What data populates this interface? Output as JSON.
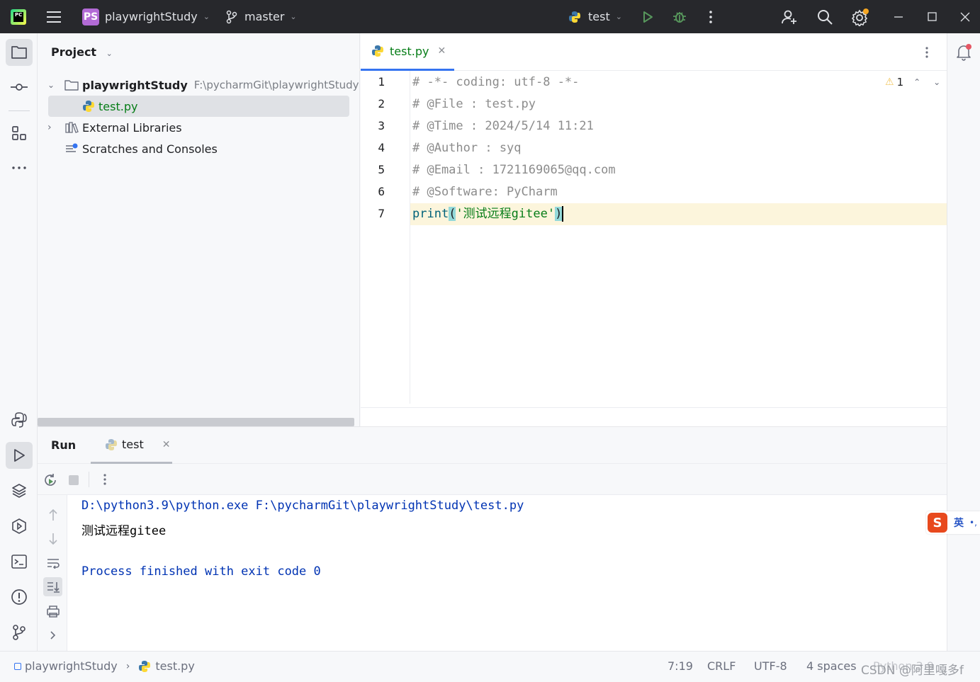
{
  "titlebar": {
    "project_badge": "PS",
    "project_name": "playwrightStudy",
    "branch": "master",
    "run_config": "test",
    "logo_text": "PC",
    "icons": [
      "pycharm-logo-icon",
      "hamburger-menu-icon",
      "branch-icon",
      "python-icon",
      "run-icon",
      "debug-icon",
      "more-vert-icon",
      "add-user-icon",
      "search-icon",
      "settings-icon",
      "minimize-icon",
      "maximize-icon",
      "close-icon"
    ]
  },
  "project_panel": {
    "title": "Project",
    "tree": [
      {
        "label": "playwrightStudy",
        "hint": "F:\\pycharmGit\\playwrightStudy",
        "icon": "folder-icon"
      },
      {
        "label": "test.py",
        "icon": "python-file-icon"
      },
      {
        "label": "External Libraries",
        "icon": "library-icon"
      },
      {
        "label": "Scratches and Consoles",
        "icon": "scratches-icon"
      }
    ]
  },
  "editor": {
    "tab_label": "test.py",
    "warning_count": "1",
    "line_numbers": [
      "1",
      "2",
      "3",
      "4",
      "5",
      "6",
      "7"
    ],
    "lines": [
      "# -*- coding: utf-8 -*-",
      "# @File : test.py",
      "# @Time : 2024/5/14 11:21",
      "# @Author : syq",
      "# @Email : 1721169065@qq.com",
      "# @Software: PyCharm"
    ],
    "print_fn": "print",
    "print_open": "(",
    "print_arg": "'测试远程gitee'",
    "print_close": ")"
  },
  "run_panel": {
    "title": "Run",
    "tab_label": "test",
    "output": {
      "command": "D:\\python3.9\\python.exe F:\\pycharmGit\\playwrightStudy\\test.py",
      "result": "测试远程gitee",
      "exit": "Process finished with exit code 0"
    }
  },
  "statusbar": {
    "breadcrumb_project": "playwrightStudy",
    "breadcrumb_file": "test.py",
    "position": "7:19",
    "line_ending": "CRLF",
    "encoding": "UTF-8",
    "indent": "4 spaces",
    "watermark": "CSDN @阿里嘎多f",
    "interpreter_partial": "Python 3.9"
  },
  "ime": {
    "label": "英",
    "mode_icon": "S"
  },
  "colors": {
    "accent": "#3574f0",
    "titlebar_bg": "#27282c",
    "string_green": "#067d17",
    "keyword_blue": "#0033b3",
    "run_green": "#57965c",
    "notification_red": "#e55765"
  }
}
